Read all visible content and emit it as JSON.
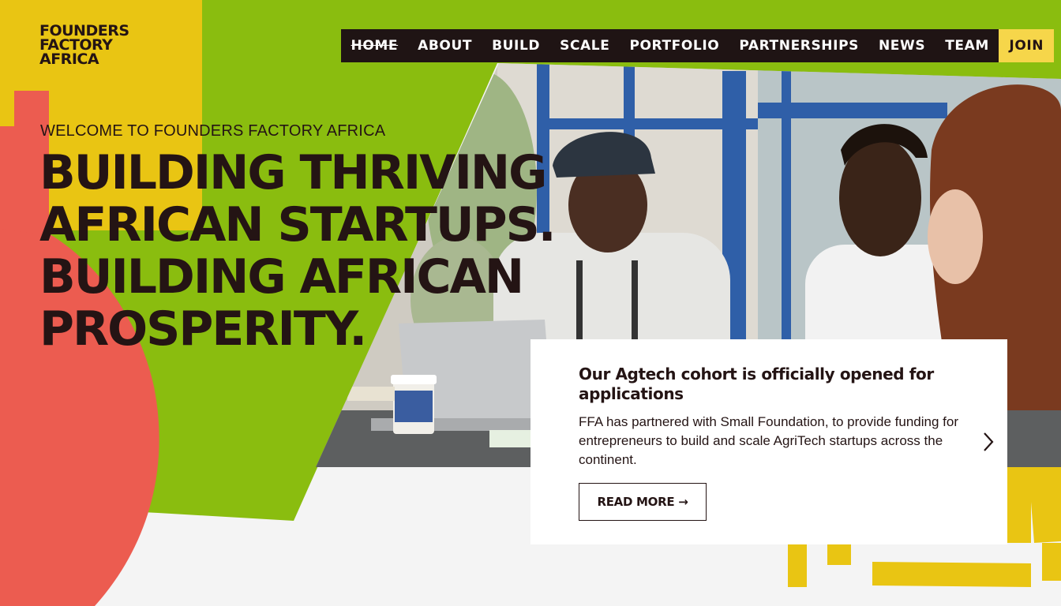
{
  "brand": {
    "logo_line1": "FOUNDERS",
    "logo_line2": "FACTORY",
    "logo_line3": "AFRICA",
    "colors": {
      "green": "#8abd0f",
      "yellow": "#e9c513",
      "red": "#ec5c50",
      "dark": "#241414",
      "nav_bg": "#1f1414",
      "join_bg": "#f6d64a"
    }
  },
  "nav": {
    "items": [
      {
        "label": "HOME"
      },
      {
        "label": "ABOUT"
      },
      {
        "label": "BUILD"
      },
      {
        "label": "SCALE"
      },
      {
        "label": "PORTFOLIO"
      },
      {
        "label": "PARTNERSHIPS"
      },
      {
        "label": "NEWS"
      },
      {
        "label": "TEAM"
      }
    ],
    "join_label": "JOIN"
  },
  "hero": {
    "welcome": "WELCOME TO FOUNDERS FACTORY AFRICA",
    "headline_lines": [
      "BUILDING THRIVING",
      "AFRICAN STARTUPS.",
      "BUILDING AFRICAN",
      "PROSPERITY."
    ]
  },
  "card": {
    "title": "Our Agtech cohort is officially opened for applications",
    "text": "FFA has partnered with Small Foundation, to provide funding for entrepreneurs to build and scale AgriTech startups across the continent.",
    "button_label": "READ MORE →",
    "next_icon": "chevron-right-icon"
  }
}
